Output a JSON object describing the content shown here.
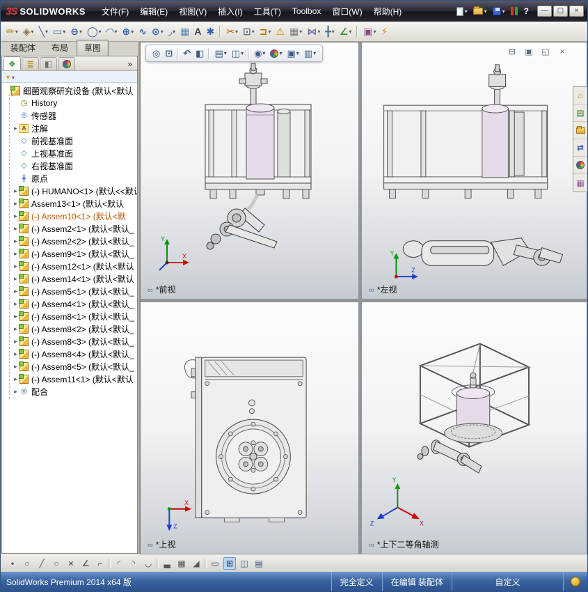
{
  "titlebar": {
    "logo_mark": "3S",
    "logo_text": "SOLIDWORKS",
    "menus": [
      "文件(F)",
      "编辑(E)",
      "视图(V)",
      "插入(I)",
      "工具(T)",
      "Toolbox",
      "窗口(W)",
      "帮助(H)"
    ],
    "quick_access": [
      {
        "name": "new-document",
        "dd": true
      },
      {
        "name": "open-document",
        "dd": true
      },
      {
        "name": "save-document",
        "dd": true
      },
      {
        "name": "status-light"
      },
      {
        "name": "help",
        "g": "?"
      }
    ],
    "window_controls": [
      {
        "name": "minimize",
        "g": "—"
      },
      {
        "name": "restore",
        "g": "▢"
      },
      {
        "name": "close",
        "g": "×"
      }
    ]
  },
  "sketch_toolbar": [
    {
      "name": "sketch",
      "g": "✏",
      "c": "#b8860b",
      "dd": true
    },
    {
      "name": "smart-dimension",
      "g": "◈",
      "c": "#8a6d3b",
      "dd": true
    },
    {
      "name": "line",
      "g": "╲",
      "c": "#3060b0",
      "dd": true
    },
    {
      "name": "corner-rectangle",
      "g": "▭",
      "c": "#3060b0",
      "dd": true
    },
    {
      "name": "straight-slot",
      "g": "⊖",
      "c": "#3060b0",
      "dd": true
    },
    {
      "name": "circle",
      "g": "◯",
      "c": "#3060b0",
      "dd": true
    },
    {
      "name": "centerpoint-arc",
      "g": "◠",
      "c": "#3060b0",
      "dd": true
    },
    {
      "name": "perimeter-circle",
      "g": "⊕",
      "c": "#3060b0",
      "dd": true
    },
    {
      "name": "spline",
      "g": "∿",
      "c": "#3060b0"
    },
    {
      "name": "ellipse",
      "g": "⊙",
      "c": "#3060b0",
      "dd": true
    },
    {
      "name": "sketch-fillet",
      "g": "◞",
      "c": "#3060b0",
      "dd": true
    },
    {
      "name": "reference-plane",
      "g": "▦",
      "c": "#5588bb"
    },
    {
      "name": "text",
      "g": "A",
      "c": "#444444"
    },
    {
      "name": "point",
      "g": "✱",
      "c": "#3060b0"
    },
    {
      "sep": true
    },
    {
      "name": "trim-entities",
      "g": "✂",
      "c": "#b06000",
      "dd": true
    },
    {
      "name": "convert-entities",
      "g": "⊡",
      "c": "#607080",
      "dd": true
    },
    {
      "name": "offset-entities",
      "g": "⊐",
      "c": "#b07800",
      "dd": true
    },
    {
      "name": "sketch-alert",
      "g": "⚠",
      "c": "#c89000"
    },
    {
      "name": "linear-sketch-pattern",
      "g": "▦",
      "c": "#787878",
      "dd": true
    },
    {
      "name": "mirror-entities",
      "g": "⋈",
      "c": "#7070a8",
      "dd": true
    },
    {
      "name": "move-entities",
      "g": "╋",
      "c": "#507090",
      "dd": true
    },
    {
      "name": "display-relations",
      "g": "∠",
      "c": "#3f8f3f",
      "dd": true
    },
    {
      "sep": true
    },
    {
      "name": "sketch-picture",
      "g": "▣",
      "c": "#8a4a8a",
      "dd": true
    },
    {
      "name": "instant-2d",
      "g": "⚡",
      "c": "#c89000"
    }
  ],
  "cm_tabs": [
    {
      "label": "装配体"
    },
    {
      "label": "布局"
    },
    {
      "label": "草图",
      "active": true
    }
  ],
  "manager_panel": {
    "chevron": "»",
    "tabs": [
      {
        "name": "featuremanager-tree-tab",
        "g": "❖",
        "c": "#3f8f3f",
        "active": true
      },
      {
        "name": "propertymanager-tab",
        "g": "≣",
        "c": "#c08a00"
      },
      {
        "name": "configurationmanager-tab",
        "g": "◧",
        "c": "#6f6f6f"
      },
      {
        "name": "displaymanager-tab",
        "ball": true
      }
    ]
  },
  "tree": {
    "items": [
      {
        "icon": "assembly",
        "warn": true,
        "root": true,
        "label": "细菌观察研究设备 (默认<默认"
      },
      {
        "icon": "history",
        "label": "History"
      },
      {
        "icon": "sensor",
        "label": "传感器"
      },
      {
        "icon": "annotation",
        "label": "注解",
        "expandable": true
      },
      {
        "icon": "plane",
        "label": "前视基准面"
      },
      {
        "icon": "plane",
        "label": "上视基准面"
      },
      {
        "icon": "plane",
        "label": "右视基准面"
      },
      {
        "icon": "origin",
        "label": "原点"
      },
      {
        "icon": "assembly",
        "label": "(-) HUMANO<1> (默认<<默认",
        "expandable": true
      },
      {
        "icon": "assembly",
        "label": "Assem13<1> (默认<默认",
        "expandable": true
      },
      {
        "icon": "assembly",
        "warn": true,
        "selected": true,
        "color": "#c05a00",
        "label": "(-) Assem10<1> (默认<默",
        "expandable": true
      },
      {
        "icon": "assembly",
        "label": "(-) Assem2<1> (默认<默认_",
        "expandable": true
      },
      {
        "icon": "assembly",
        "label": "(-) Assem2<2> (默认<默认_",
        "expandable": true
      },
      {
        "icon": "assembly",
        "label": "(-) Assem9<1> (默认<默认_",
        "expandable": true
      },
      {
        "icon": "assembly",
        "label": "(-) Assem12<1> (默认<默认",
        "expandable": true
      },
      {
        "icon": "assembly",
        "label": "(-) Assem14<1> (默认<默认",
        "expandable": true
      },
      {
        "icon": "assembly",
        "label": "(-) Assem5<1> (默认<默认_",
        "expandable": true
      },
      {
        "icon": "assembly",
        "label": "(-) Assem4<1> (默认<默认_",
        "expandable": true
      },
      {
        "icon": "assembly",
        "label": "(-) Assem8<1> (默认<默认_",
        "expandable": true
      },
      {
        "icon": "assembly",
        "label": "(-) Assem8<2> (默认<默认_",
        "expandable": true
      },
      {
        "icon": "assembly",
        "label": "(-) Assem8<3> (默认<默认_",
        "expandable": true
      },
      {
        "icon": "assembly",
        "label": "(-) Assem8<4> (默认<默认_",
        "expandable": true
      },
      {
        "icon": "assembly",
        "label": "(-) Assem8<5> (默认<默认_",
        "expandable": true
      },
      {
        "icon": "assembly",
        "label": "(-) Assem11<1> (默认<默认",
        "expandable": true
      },
      {
        "icon": "mates",
        "label": "配合",
        "expandable": true
      }
    ]
  },
  "hud": [
    {
      "name": "zoom-to-fit",
      "g": "◎",
      "c": "#3a5a8a"
    },
    {
      "name": "zoom-to-area",
      "g": "⊡",
      "c": "#3a5a8a"
    },
    {
      "sep": true
    },
    {
      "name": "previous-view",
      "g": "↶",
      "c": "#3a5a8a"
    },
    {
      "name": "section-view",
      "g": "◧",
      "c": "#3a5a8a"
    },
    {
      "sep": true
    },
    {
      "name": "view-orientation",
      "g": "▤",
      "c": "#3a5a8a",
      "dd": true
    },
    {
      "name": "display-style",
      "g": "◫",
      "c": "#3a5a8a",
      "dd": true
    },
    {
      "sep": true
    },
    {
      "name": "hide-show-items",
      "g": "◉",
      "c": "#3a5a8a",
      "dd": true
    },
    {
      "name": "edit-appearance",
      "ball": true,
      "dd": true
    },
    {
      "name": "apply-scene",
      "g": "▣",
      "c": "#3a5a8a",
      "dd": true
    },
    {
      "name": "view-settings",
      "g": "▥",
      "c": "#3a5a8a",
      "dd": true
    }
  ],
  "doc_controls": [
    {
      "name": "doc-minimize",
      "g": "⊟"
    },
    {
      "name": "doc-tile",
      "g": "▣"
    },
    {
      "name": "doc-restore",
      "g": "◱"
    },
    {
      "name": "doc-close",
      "g": "×"
    }
  ],
  "viewports": [
    {
      "label": "*前视"
    },
    {
      "label": "*左视"
    },
    {
      "label": "*上视"
    },
    {
      "label": "*上下二等角轴测"
    }
  ],
  "triads": {
    "front": {
      "up": "Y",
      "right": "X"
    },
    "left": {
      "up": "Y",
      "right": "Z"
    },
    "top": {
      "right": "X",
      "down": "Z"
    },
    "iso": {
      "up": "Y",
      "right": "X",
      "left": "Z"
    }
  },
  "task_pane": [
    {
      "name": "solidworks-resources",
      "g": "⌂",
      "c": "#c87820"
    },
    {
      "name": "design-library",
      "g": "▤",
      "c": "#2f8a2f"
    },
    {
      "name": "file-explorer",
      "folder": true
    },
    {
      "name": "view-palette",
      "g": "⇄",
      "c": "#2a5ad0"
    },
    {
      "name": "appearances-scenes",
      "ball": true
    },
    {
      "name": "custom-properties",
      "g": "▦",
      "c": "#8a5aa0"
    }
  ],
  "bottom_toolbar": [
    {
      "name": "select-point",
      "g": "•",
      "c": "#555555"
    },
    {
      "name": "snap-circle",
      "g": "○",
      "c": "#555555"
    },
    {
      "name": "snap-line",
      "g": "╱",
      "c": "#555555"
    },
    {
      "name": "snap-ellipse",
      "g": "○",
      "c": "#555555"
    },
    {
      "name": "snap-intersection",
      "g": "×",
      "c": "#555555"
    },
    {
      "name": "snap-angle",
      "g": "∠",
      "c": "#555555"
    },
    {
      "name": "snap-perpendicular",
      "g": "⌐",
      "c": "#555555"
    },
    {
      "sep": true
    },
    {
      "name": "snap-arc-left",
      "g": "◜",
      "c": "#555555"
    },
    {
      "name": "snap-arc-right",
      "g": "◝",
      "c": "#555555"
    },
    {
      "name": "snap-tangent",
      "g": "◡",
      "c": "#555555"
    },
    {
      "sep": true
    },
    {
      "name": "snap-grid",
      "g": "▃",
      "c": "#555555"
    },
    {
      "name": "grid-settings",
      "g": "▦",
      "c": "#555555"
    },
    {
      "name": "snap-corner",
      "g": "◢",
      "c": "#555555"
    },
    {
      "sep": true
    },
    {
      "name": "viewport-single",
      "g": "▭",
      "c": "#33507a"
    },
    {
      "name": "viewport-four",
      "g": "⊞",
      "c": "#33507a",
      "active": true
    },
    {
      "name": "viewport-two-horizontal",
      "g": "◫",
      "c": "#33507a"
    },
    {
      "name": "viewport-two-vertical",
      "g": "▤",
      "c": "#33507a"
    }
  ],
  "statusbar": {
    "left_text": "SolidWorks Premium 2014 x64 版",
    "cells": [
      {
        "label": "完全定义"
      },
      {
        "label": "在编辑 装配体"
      },
      {
        "label": "自定义",
        "wide": true
      }
    ]
  },
  "colors": {
    "titlebar_bg": "#26262f",
    "statusbar_bg": "#2d5290",
    "selection_orange": "#c05a00",
    "viewport_gradient_top": "#fcfcfd",
    "viewport_gradient_bottom": "#c6cbd1"
  }
}
